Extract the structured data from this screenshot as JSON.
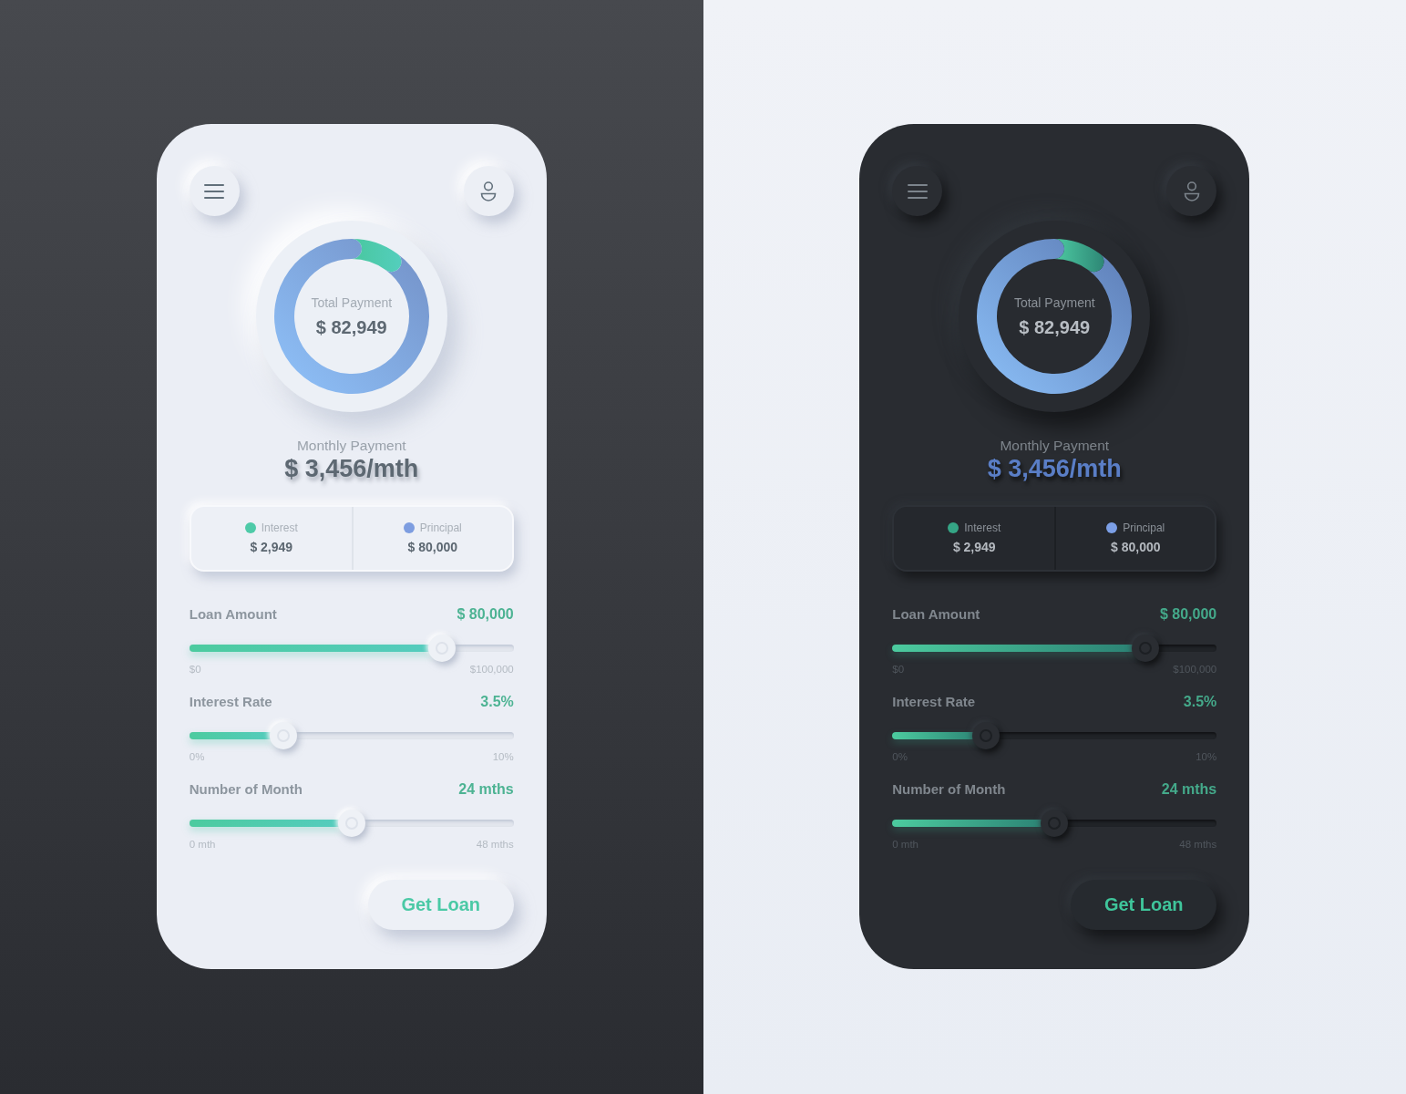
{
  "screens": [
    {
      "kind": "light",
      "total_payment": {
        "label": "Total Payment",
        "value": "$ 82,949"
      },
      "monthly_payment": {
        "label": "Monthly Payment",
        "value": "$ 3,456/mth"
      },
      "legend": [
        {
          "label": "Interest",
          "value": "$ 2,949",
          "color": "#4ecaa8"
        },
        {
          "label": "Principal",
          "value": "$ 80,000",
          "color": "#7d9de0"
        }
      ],
      "sliders": [
        {
          "label": "Loan Amount",
          "value": "$ 80,000",
          "level": 0.78,
          "min": "$0",
          "max": "$100,000"
        },
        {
          "label": "Interest Rate",
          "value": "3.5%",
          "level": 0.29,
          "min": "0%",
          "max": "10%"
        },
        {
          "label": "Number of Month",
          "value": "24 mths",
          "level": 0.5,
          "min": "0 mth",
          "max": "48 mths"
        }
      ],
      "button": "Get Loan"
    },
    {
      "kind": "dark",
      "total_payment": {
        "label": "Total Payment",
        "value": "$ 82,949"
      },
      "monthly_payment": {
        "label": "Monthly Payment",
        "value": "$ 3,456/mth"
      },
      "legend": [
        {
          "label": "Interest",
          "value": "$ 2,949",
          "color": "#35a585"
        },
        {
          "label": "Principal",
          "value": "$ 80,000",
          "color": "#7c9fe6"
        }
      ],
      "sliders": [
        {
          "label": "Loan Amount",
          "value": "$ 80,000",
          "level": 0.78,
          "min": "$0",
          "max": "$100,000"
        },
        {
          "label": "Interest Rate",
          "value": "3.5%",
          "level": 0.29,
          "min": "0%",
          "max": "10%"
        },
        {
          "label": "Number of Month",
          "value": "24 mths",
          "level": 0.5,
          "min": "0 mth",
          "max": "48 mths"
        }
      ],
      "button": "Get Loan"
    }
  ]
}
